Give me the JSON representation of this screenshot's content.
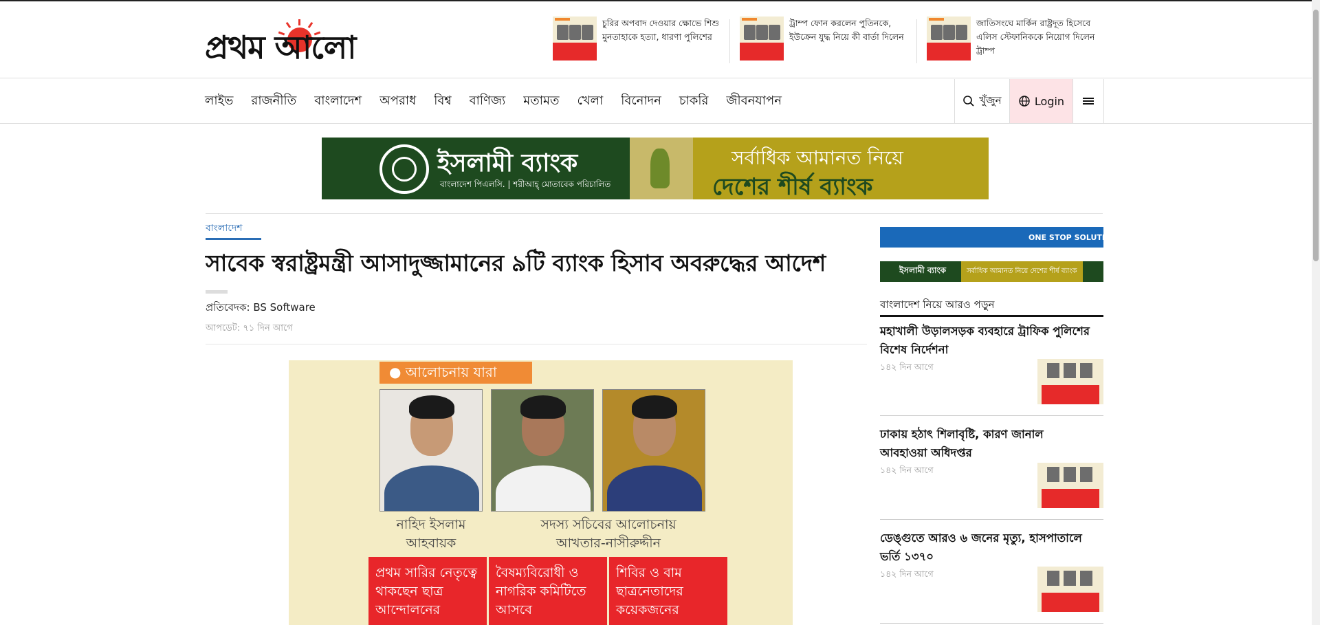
{
  "logo": {
    "text": "প্রথম আলো"
  },
  "top_news": [
    {
      "title": "চুরির অপবাদ দেওয়ার ক্ষোভে শিশু মুনতাহাকে হত্যা, ধারণা পুলিশের"
    },
    {
      "title": "ট্রাম্প ফোন করলেন পুতিনকে, ইউক্রেন যুদ্ধ নিয়ে কী বার্তা দিলেন"
    },
    {
      "title": "জাতিসংঘে মার্কিন রাষ্ট্রদূত হিসেবে এলিস স্টেফানিককে নিয়োগ দিলেন ট্রাম্প"
    }
  ],
  "nav": {
    "items": [
      "লাইভ",
      "রাজনীতি",
      "বাংলাদেশ",
      "অপরাধ",
      "বিশ্ব",
      "বাণিজ্য",
      "মতামত",
      "খেলা",
      "বিনোদন",
      "চাকরি",
      "জীবনযাপন"
    ],
    "search_label": "খুঁজুন",
    "login_label": "Login",
    "search_icon": "search-icon",
    "globe_icon": "globe-icon",
    "menu_icon": "hamburger-menu-icon"
  },
  "ad_banner": {
    "brand": "ইসলামী ব্যাংক",
    "brand_sub": "বাংলাদেশ পিএলসি. | শরীআহ্‌ মোতাবেক পরিচালিত",
    "line1": "সর্বাধিক আমানত নিয়ে",
    "line2": "দেশের শীর্ষ ব্যাংক",
    "colors": {
      "green": "#1e4a1f",
      "gold": "#b5a11b"
    }
  },
  "article": {
    "category": "বাংলাদেশ",
    "headline": "সাবেক স্বরাষ্ট্রমন্ত্রী আসাদুজ্জামানের ৯টি ব্যাংক হিসাব অবরুদ্ধের আদেশ",
    "reporter": "প্রতিবেদক: BS Software",
    "updated": "আপডেট: ৭১ দিন আগে",
    "image": {
      "tag": "● আলোচনায় যারা",
      "caption_left": [
        "নাহিদ ইসলাম",
        "আহবায়ক"
      ],
      "caption_right": [
        "সদস্য সচিবের আলোচনায়",
        "আখতার-নাসীরুদ্দীন"
      ],
      "box1": "প্রথম সারির নেতৃত্বে থাকছেন ছাত্র আন্দোলনের",
      "box2": "বৈষম্যবিরোধী ও নাগরিক কমিটিতে আসবে",
      "box3": "শিবির ও বাম ছাত্রনেতাদের কয়েকজনের"
    }
  },
  "sidebar": {
    "ad1_text": "ONE STOP SOLUTION  GREE",
    "ad2_brand": "ইসলামী ব্যাংক",
    "ad2_tagline": "সর্বাধিক আমানত নিয়ে দেশের শীর্ষ ব্যাংক",
    "heading": "বাংলাদেশ নিয়ে আরও পড়ুন",
    "items": [
      {
        "title": "মহাখালী উড়ালসড়ক ব্যবহারে ট্রাফিক পুলিশের বিশেষ নির্দেশনা",
        "time": "১৪২ দিন আগে"
      },
      {
        "title": "ঢাকায় হঠাৎ শিলাবৃষ্টি, কারণ জানাল আবহাওয়া অধিদপ্তর",
        "time": "১৪২ দিন আগে"
      },
      {
        "title": "ডেঙ্গুতে আরও ৬ জনের মৃত্যু, হাসপাতালে ভর্তি ১৩৭০",
        "time": "১৪২ দিন আগে"
      }
    ]
  }
}
